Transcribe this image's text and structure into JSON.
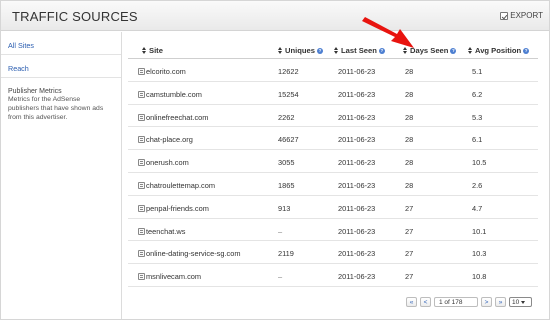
{
  "window": {
    "title": "TRAFFIC SOURCES",
    "export_label": "EXPORT"
  },
  "sidebar": {
    "items": [
      {
        "label": "All Sites"
      },
      {
        "label": "Reach"
      }
    ],
    "section": {
      "title": "Publisher Metrics",
      "description": "Metrics for the AdSense publishers that have shown ads from this advertiser."
    }
  },
  "table": {
    "columns": [
      {
        "label": "Site"
      },
      {
        "label": "Uniques"
      },
      {
        "label": "Last Seen"
      },
      {
        "label": "Days Seen"
      },
      {
        "label": "Avg Position"
      }
    ],
    "rows": [
      {
        "site": "elcorito.com",
        "uniques": "12622",
        "last_seen": "2011-06-23",
        "days_seen": "28",
        "avg_position": "5.1"
      },
      {
        "site": "camstumble.com",
        "uniques": "15254",
        "last_seen": "2011-06-23",
        "days_seen": "28",
        "avg_position": "6.2"
      },
      {
        "site": "onlinefreechat.com",
        "uniques": "2262",
        "last_seen": "2011-06-23",
        "days_seen": "28",
        "avg_position": "5.3"
      },
      {
        "site": "chat-place.org",
        "uniques": "46627",
        "last_seen": "2011-06-23",
        "days_seen": "28",
        "avg_position": "6.1"
      },
      {
        "site": "onerush.com",
        "uniques": "3055",
        "last_seen": "2011-06-23",
        "days_seen": "28",
        "avg_position": "10.5"
      },
      {
        "site": "chatroulettemap.com",
        "uniques": "1865",
        "last_seen": "2011-06-23",
        "days_seen": "28",
        "avg_position": "2.6"
      },
      {
        "site": "penpal-friends.com",
        "uniques": "913",
        "last_seen": "2011-06-23",
        "days_seen": "27",
        "avg_position": "4.7"
      },
      {
        "site": "teenchat.ws",
        "uniques": "–",
        "last_seen": "2011-06-23",
        "days_seen": "27",
        "avg_position": "10.1"
      },
      {
        "site": "online-dating-service-sg.com",
        "uniques": "2119",
        "last_seen": "2011-06-23",
        "days_seen": "27",
        "avg_position": "10.3"
      },
      {
        "site": "msnlivecam.com",
        "uniques": "–",
        "last_seen": "2011-06-23",
        "days_seen": "27",
        "avg_position": "10.8"
      }
    ]
  },
  "pagination": {
    "first": "«",
    "prev": "<",
    "page_text": "1 of 178",
    "next": ">",
    "last": "»",
    "page_size": "10"
  },
  "colors": {
    "link": "#2a5db0",
    "annotation_arrow": "#e8140f"
  },
  "icons": {
    "export": "export-icon",
    "site": "site-icon",
    "sort": "sort-icon",
    "help": "help-icon"
  }
}
